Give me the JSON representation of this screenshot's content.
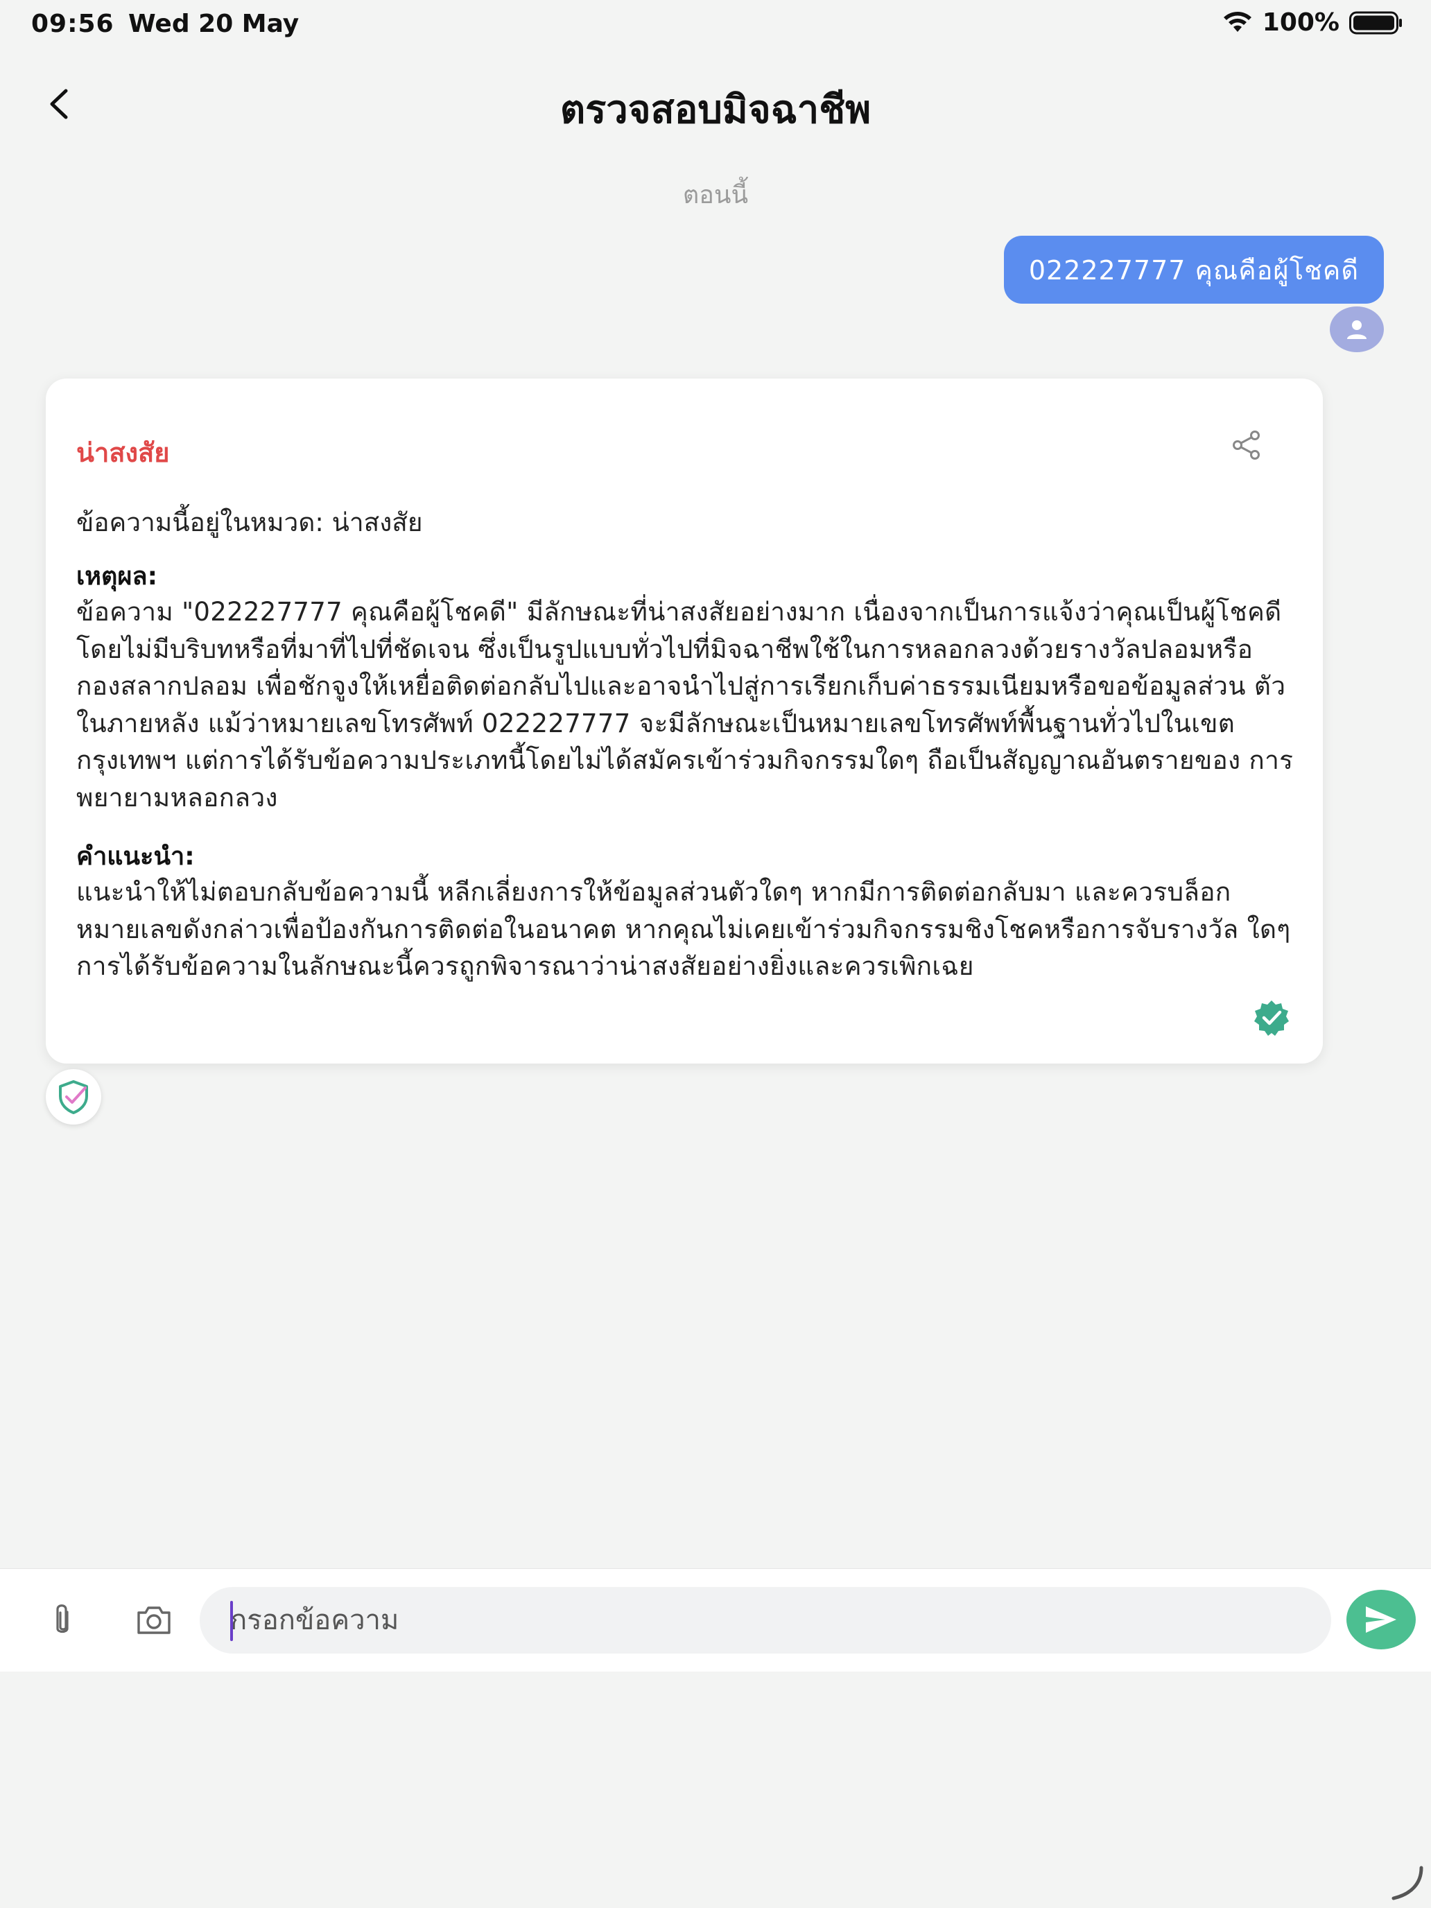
{
  "status_bar": {
    "time": "09:56",
    "date": "Wed 20 May",
    "battery": "100%"
  },
  "header": {
    "title": "ตรวจสอบมิจฉาชีพ",
    "back_icon": "chevron-left-icon"
  },
  "chat": {
    "timestamp": "ตอนนี้",
    "user_message": "022227777 คุณคือผู้โชคดี",
    "result": {
      "verdict": "น่าสงสัย",
      "category_line": "ข้อความนี้อยู่ในหมวด: น่าสงสัย",
      "reason_heading": "เหตุผล:",
      "reason_body": "ข้อความ \"022227777 คุณคือผู้โชคดี\" มีลักษณะที่น่าสงสัยอย่างมาก เนื่องจากเป็นการแจ้งว่าคุณเป็นผู้โชคดี โดยไม่มีบริบทหรือที่มาที่ไปที่ชัดเจน ซึ่งเป็นรูปแบบทั่วไปที่มิจฉาชีพใช้ในการหลอกลวงด้วยรางวัลปลอมหรือ กองสลากปลอม เพื่อชักจูงให้เหยื่อติดต่อกลับไปและอาจนำไปสู่การเรียกเก็บค่าธรรมเนียมหรือขอข้อมูลส่วน ตัวในภายหลัง แม้ว่าหมายเลขโทรศัพท์ 022227777 จะมีลักษณะเป็นหมายเลขโทรศัพท์พื้นฐานทั่วไปในเขต กรุงเทพฯ แต่การได้รับข้อความประเภทนี้โดยไม่ได้สมัครเข้าร่วมกิจกรรมใดๆ ถือเป็นสัญญาณอันตรายของ การพยายามหลอกลวง",
      "advice_heading": "คำแนะนำ:",
      "advice_body": "แนะนำให้ไม่ตอบกลับข้อความนี้ หลีกเลี่ยงการให้ข้อมูลส่วนตัวใดๆ หากมีการติดต่อกลับมา และควรบล็อก หมายเลขดังกล่าวเพื่อป้องกันการติดต่อในอนาคต หากคุณไม่เคยเข้าร่วมกิจกรรมชิงโชคหรือการจับรางวัล ใดๆ การได้รับข้อความในลักษณะนี้ควรถูกพิจารณาว่าน่าสงสัยอย่างยิ่งและควรเพิกเฉย"
    }
  },
  "input": {
    "placeholder": "กรอกข้อความ"
  },
  "colors": {
    "user_bubble": "#5b8def",
    "verdict": "#e04848",
    "accent_green": "#4cbf91",
    "background": "#f3f4f3"
  }
}
